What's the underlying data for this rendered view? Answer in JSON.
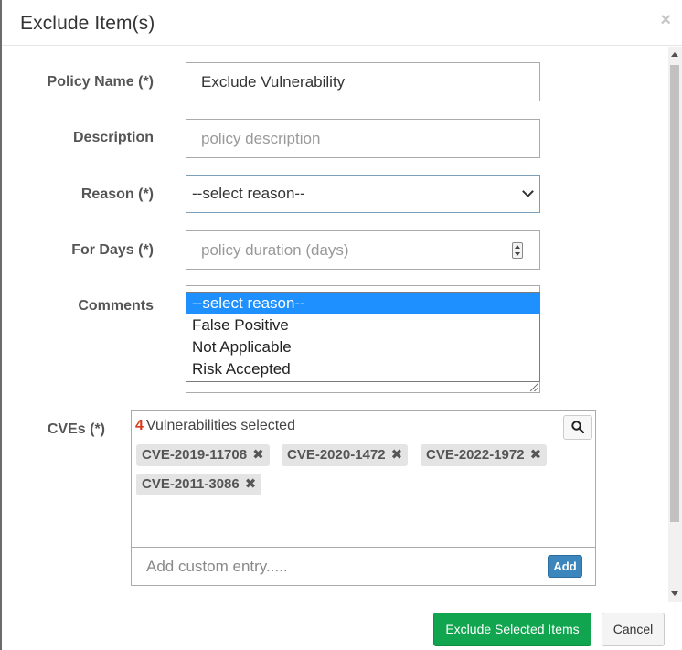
{
  "modal": {
    "title": "Exclude Item(s)",
    "close_symbol": "×"
  },
  "form": {
    "policy_name": {
      "label": "Policy Name (*)",
      "value": "Exclude Vulnerability"
    },
    "description": {
      "label": "Description",
      "placeholder": "policy description"
    },
    "reason": {
      "label": "Reason (*)",
      "selected": "--select reason--",
      "options": [
        "--select reason--",
        "False Positive",
        "Not Applicable",
        "Risk Accepted"
      ]
    },
    "for_days": {
      "label": "For Days (*)",
      "placeholder": "policy duration (days)"
    },
    "comments": {
      "label": "Comments"
    },
    "cves": {
      "label": "CVEs (*)",
      "selected_count": "4",
      "selected_text": "Vulnerabilities selected",
      "chips": [
        "CVE-2019-11708",
        "CVE-2020-1472",
        "CVE-2022-1972",
        "CVE-2011-3086"
      ],
      "chip_remove_symbol": "✖",
      "custom_placeholder": "Add custom entry.....",
      "add_label": "Add"
    }
  },
  "footer": {
    "primary_label": "Exclude Selected Items",
    "cancel_label": "Cancel"
  },
  "colors": {
    "primary": "#12a550",
    "add_button": "#3a86bd",
    "option_highlight": "#1e90ff",
    "count": "#d9381e"
  }
}
